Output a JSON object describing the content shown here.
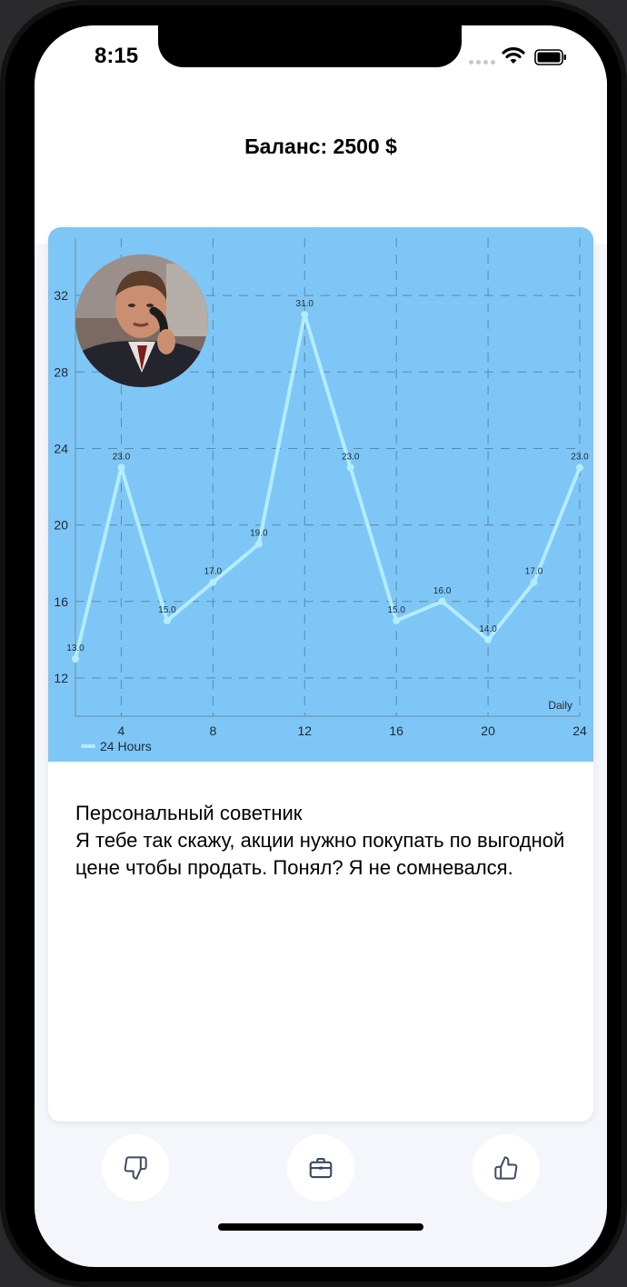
{
  "status_bar": {
    "time": "8:15"
  },
  "header": {
    "balance": "Баланс: 2500 $"
  },
  "advisor": {
    "title": "Персональный советник",
    "message": "Я тебе так скажу, акции нужно покупать по выгодной цене чтобы продать. Понял? Я не сомневался."
  },
  "actions": {
    "dislike_icon": "thumbs-down-icon",
    "portfolio_icon": "briefcase-icon",
    "like_icon": "thumbs-up-icon"
  },
  "colors": {
    "chart_background": "#7ec6f5",
    "line": "#b4ecff",
    "grid": "#5b8aab"
  },
  "chart_data": {
    "type": "line",
    "x": [
      2,
      4,
      6,
      8,
      10,
      12,
      14,
      16,
      18,
      20,
      22,
      24
    ],
    "series": [
      {
        "name": "24 Hours",
        "values": [
          13.0,
          23.0,
          15.0,
          17.0,
          19.0,
          31.0,
          23.0,
          15.0,
          16.0,
          14.0,
          17.0,
          23.0
        ]
      }
    ],
    "data_labels": [
      "13.0",
      "23.0",
      "15.0",
      "17.0",
      "19.0",
      "31.0",
      "23.0",
      "15.0",
      "16.0",
      "14.0",
      "17.0",
      "23.0"
    ],
    "x_ticks": [
      "4",
      "8",
      "12",
      "16",
      "20",
      "24"
    ],
    "y_ticks": [
      "12",
      "16",
      "20",
      "24",
      "28",
      "32"
    ],
    "xlim": [
      2,
      24
    ],
    "ylim": [
      10,
      35
    ],
    "xlabel": "Daily",
    "legend": "bottom-left",
    "grid": true
  }
}
